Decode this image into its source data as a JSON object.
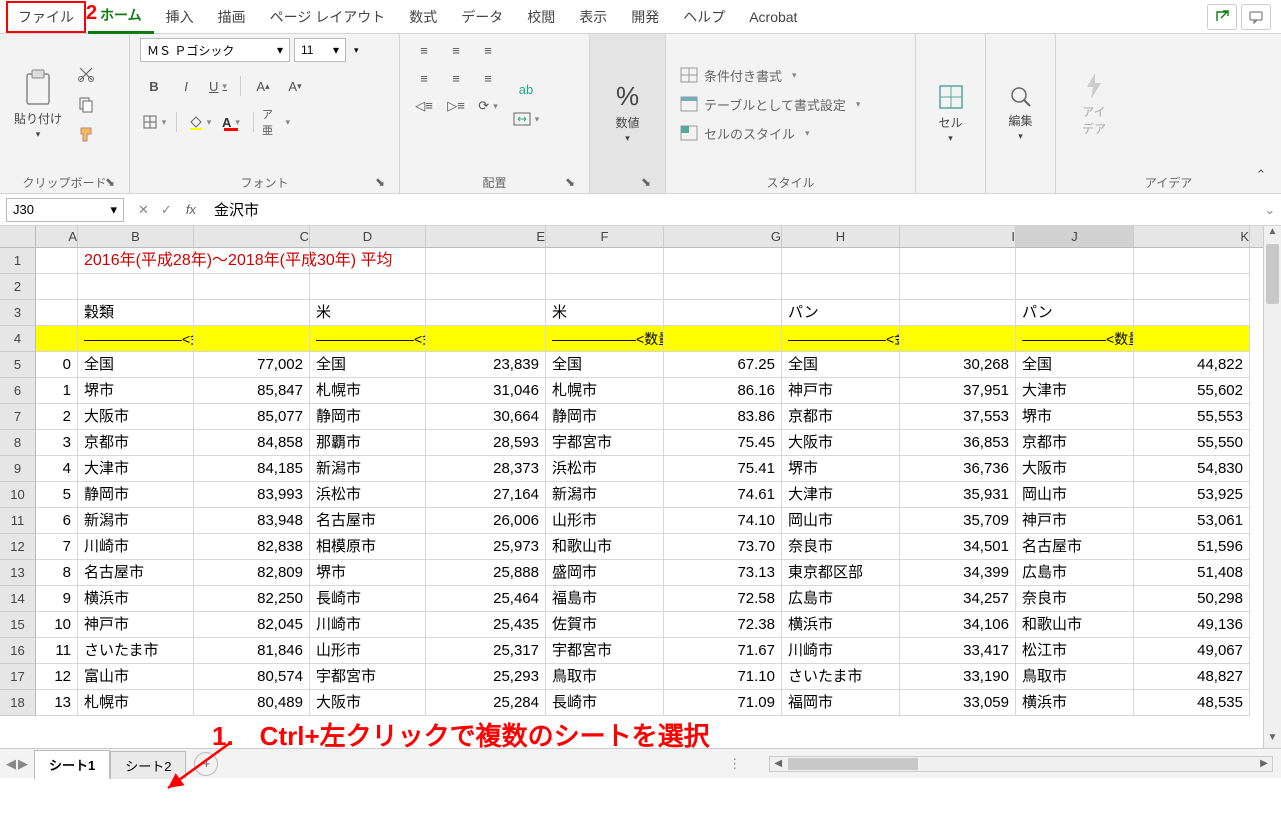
{
  "tabs": {
    "file": "ファイル",
    "home": "ホーム",
    "insert": "挿入",
    "draw": "描画",
    "layout": "ページ レイアウト",
    "formula": "数式",
    "data": "データ",
    "review": "校閲",
    "view": "表示",
    "dev": "開発",
    "help": "ヘルプ",
    "acrobat": "Acrobat"
  },
  "ribbon": {
    "clipboard": {
      "label": "クリップボード",
      "paste": "貼り付け"
    },
    "font": {
      "label": "フォント",
      "name": "ＭＳ Ｐゴシック",
      "size": "11",
      "bold": "B",
      "italic": "I",
      "underline": "U",
      "phonetic": "ア亜"
    },
    "align": {
      "label": "配置",
      "wrap": "ab"
    },
    "number": {
      "label": "数値",
      "big": "%",
      "big2": "数値"
    },
    "styles": {
      "label": "スタイル",
      "cond": "条件付き書式",
      "table": "テーブルとして書式設定",
      "cell": "セルのスタイル"
    },
    "cells": {
      "label": "セル"
    },
    "editing": {
      "label": "編集"
    },
    "ideas": {
      "label": "アイデア",
      "btn": "アイ\nデア"
    }
  },
  "namebox": "J30",
  "formula": "金沢市",
  "cols": [
    "A",
    "B",
    "C",
    "D",
    "E",
    "F",
    "G",
    "H",
    "I",
    "J",
    "K"
  ],
  "title": "2016年(平成28年)～2018年(平成30年) 平均",
  "headers": {
    "B": "穀類",
    "D": "米",
    "F": "米",
    "H": "パン",
    "J": "パン"
  },
  "subheaders": {
    "B": "―――――――<金　額>―",
    "D": "―――――――<金　額>―",
    "F": "――――――<数量:ｋｇ>―",
    "H": "―――――――<金　額>―",
    "J": "――――――<数量: ｇ>―"
  },
  "rows": [
    {
      "n": "5",
      "A": "0",
      "B": "全国",
      "C": "77,002",
      "D": "全国",
      "E": "23,839",
      "F": "全国",
      "G": "67.25",
      "H": "全国",
      "I": "30,268",
      "J": "全国",
      "K": "44,822"
    },
    {
      "n": "6",
      "A": "1",
      "B": "堺市",
      "C": "85,847",
      "D": "札幌市",
      "E": "31,046",
      "F": "札幌市",
      "G": "86.16",
      "H": "神戸市",
      "I": "37,951",
      "J": "大津市",
      "K": "55,602"
    },
    {
      "n": "7",
      "A": "2",
      "B": "大阪市",
      "C": "85,077",
      "D": "静岡市",
      "E": "30,664",
      "F": "静岡市",
      "G": "83.86",
      "H": "京都市",
      "I": "37,553",
      "J": "堺市",
      "K": "55,553"
    },
    {
      "n": "8",
      "A": "3",
      "B": "京都市",
      "C": "84,858",
      "D": "那覇市",
      "E": "28,593",
      "F": "宇都宮市",
      "G": "75.45",
      "H": "大阪市",
      "I": "36,853",
      "J": "京都市",
      "K": "55,550"
    },
    {
      "n": "9",
      "A": "4",
      "B": "大津市",
      "C": "84,185",
      "D": "新潟市",
      "E": "28,373",
      "F": "浜松市",
      "G": "75.41",
      "H": "堺市",
      "I": "36,736",
      "J": "大阪市",
      "K": "54,830"
    },
    {
      "n": "10",
      "A": "5",
      "B": "静岡市",
      "C": "83,993",
      "D": "浜松市",
      "E": "27,164",
      "F": "新潟市",
      "G": "74.61",
      "H": "大津市",
      "I": "35,931",
      "J": "岡山市",
      "K": "53,925"
    },
    {
      "n": "11",
      "A": "6",
      "B": "新潟市",
      "C": "83,948",
      "D": "名古屋市",
      "E": "26,006",
      "F": "山形市",
      "G": "74.10",
      "H": "岡山市",
      "I": "35,709",
      "J": "神戸市",
      "K": "53,061"
    },
    {
      "n": "12",
      "A": "7",
      "B": "川崎市",
      "C": "82,838",
      "D": "相模原市",
      "E": "25,973",
      "F": "和歌山市",
      "G": "73.70",
      "H": "奈良市",
      "I": "34,501",
      "J": "名古屋市",
      "K": "51,596"
    },
    {
      "n": "13",
      "A": "8",
      "B": "名古屋市",
      "C": "82,809",
      "D": "堺市",
      "E": "25,888",
      "F": "盛岡市",
      "G": "73.13",
      "H": "東京都区部",
      "I": "34,399",
      "J": "広島市",
      "K": "51,408"
    },
    {
      "n": "14",
      "A": "9",
      "B": "横浜市",
      "C": "82,250",
      "D": "長崎市",
      "E": "25,464",
      "F": "福島市",
      "G": "72.58",
      "H": "広島市",
      "I": "34,257",
      "J": "奈良市",
      "K": "50,298"
    },
    {
      "n": "15",
      "A": "10",
      "B": "神戸市",
      "C": "82,045",
      "D": "川崎市",
      "E": "25,435",
      "F": "佐賀市",
      "G": "72.38",
      "H": "横浜市",
      "I": "34,106",
      "J": "和歌山市",
      "K": "49,136"
    },
    {
      "n": "16",
      "A": "11",
      "B": "さいたま市",
      "C": "81,846",
      "D": "山形市",
      "E": "25,317",
      "F": "宇都宮市",
      "G": "71.67",
      "H": "川崎市",
      "I": "33,417",
      "J": "松江市",
      "K": "49,067"
    },
    {
      "n": "17",
      "A": "12",
      "B": "富山市",
      "C": "80,574",
      "D": "宇都宮市",
      "E": "25,293",
      "F": "鳥取市",
      "G": "71.10",
      "H": "さいたま市",
      "I": "33,190",
      "J": "鳥取市",
      "K": "48,827"
    },
    {
      "n": "18",
      "A": "13",
      "B": "札幌市",
      "C": "80,489",
      "D": "大阪市",
      "E": "25,284",
      "F": "長崎市",
      "G": "71.09",
      "H": "福岡市",
      "I": "33,059",
      "J": "横浜市",
      "K": "48,535"
    }
  ],
  "sheets": {
    "s1": "シート1",
    "s2": "シート2"
  },
  "annot": {
    "n1": "1.　Ctrl+左クリックで複数のシートを選択",
    "n2": "2"
  }
}
